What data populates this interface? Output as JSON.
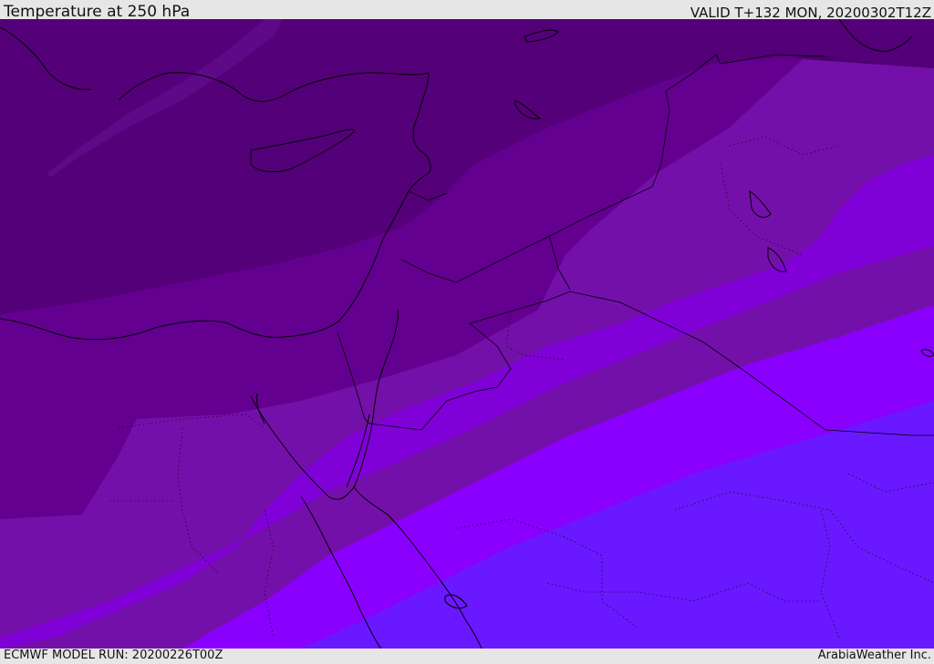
{
  "header": {
    "title": "Temperature at 250 hPa",
    "valid_time": "VALID T+132 MON, 20200302T12Z"
  },
  "footer": {
    "model_run": "ECMWF MODEL RUN: 20200226T00Z",
    "credit": "ArabiaWeather Inc."
  },
  "map": {
    "variable": "temperature",
    "pressure_level_hpa": 250,
    "fill_colors": {
      "band_1": "#4a0070",
      "band_2": "#540078",
      "band_3": "#630090",
      "band_4": "#7410aa",
      "band_5": "#8000d8",
      "band_6": "#8a00ff",
      "band_7": "#6a18ff"
    },
    "coastline_color": "#000000",
    "border_style": "dotted"
  }
}
